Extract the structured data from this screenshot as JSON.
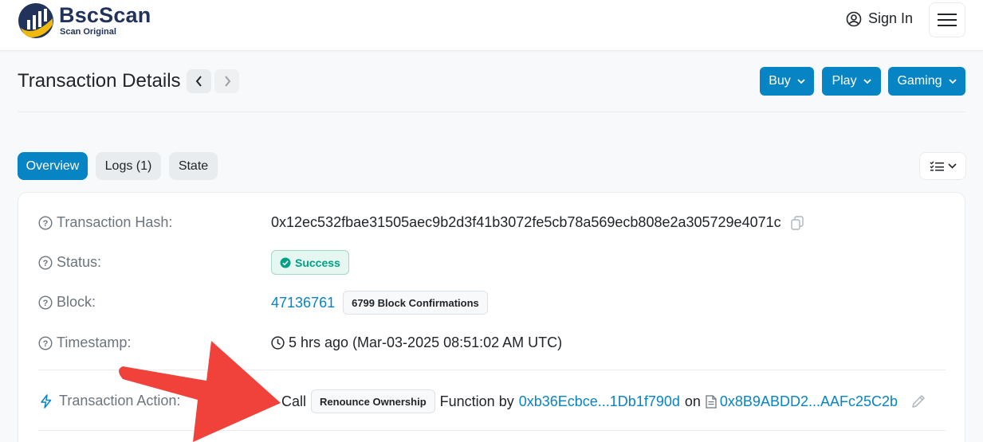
{
  "header": {
    "logo_name": "BscScan",
    "logo_sub": "Scan Original",
    "signin_label": "Sign In"
  },
  "title_row": {
    "title": "Transaction Details",
    "buttons": [
      {
        "label": "Buy"
      },
      {
        "label": "Play"
      },
      {
        "label": "Gaming"
      }
    ]
  },
  "tabs": [
    {
      "label": "Overview",
      "active": true
    },
    {
      "label": "Logs (1)",
      "active": false
    },
    {
      "label": "State",
      "active": false
    }
  ],
  "details": {
    "hash_label": "Transaction Hash:",
    "hash_value": "0x12ec532fbae31505aec9b2d3f41b3072fe5cb78a569ecb808e2a305729e4071c",
    "status_label": "Status:",
    "status_value": "Success",
    "block_label": "Block:",
    "block_value": "47136761",
    "block_confirmations": "6799 Block Confirmations",
    "timestamp_label": "Timestamp:",
    "timestamp_value": "5 hrs ago (Mar-03-2025 08:51:02 AM UTC)",
    "action_label": "Transaction Action:",
    "action_call": "Call",
    "action_function": "Renounce Ownership",
    "action_by": "Function by",
    "action_from": "0xb36Ecbce...1Db1f790d",
    "action_on": "on",
    "action_contract": "0x8B9ABDD2...AAFc25C2b"
  },
  "colors": {
    "primary": "#0784c3",
    "success": "#00a186",
    "annotation_arrow": "#f0413b"
  },
  "icons": {
    "logo": "bscscan-logo-icon",
    "user": "user-circle-icon",
    "menu": "hamburger-icon",
    "help": "question-circle-icon",
    "copy": "copy-icon",
    "check": "check-circle-icon",
    "clock": "clock-icon",
    "lightning": "lightning-icon",
    "file": "file-icon",
    "edit": "pencil-icon"
  }
}
